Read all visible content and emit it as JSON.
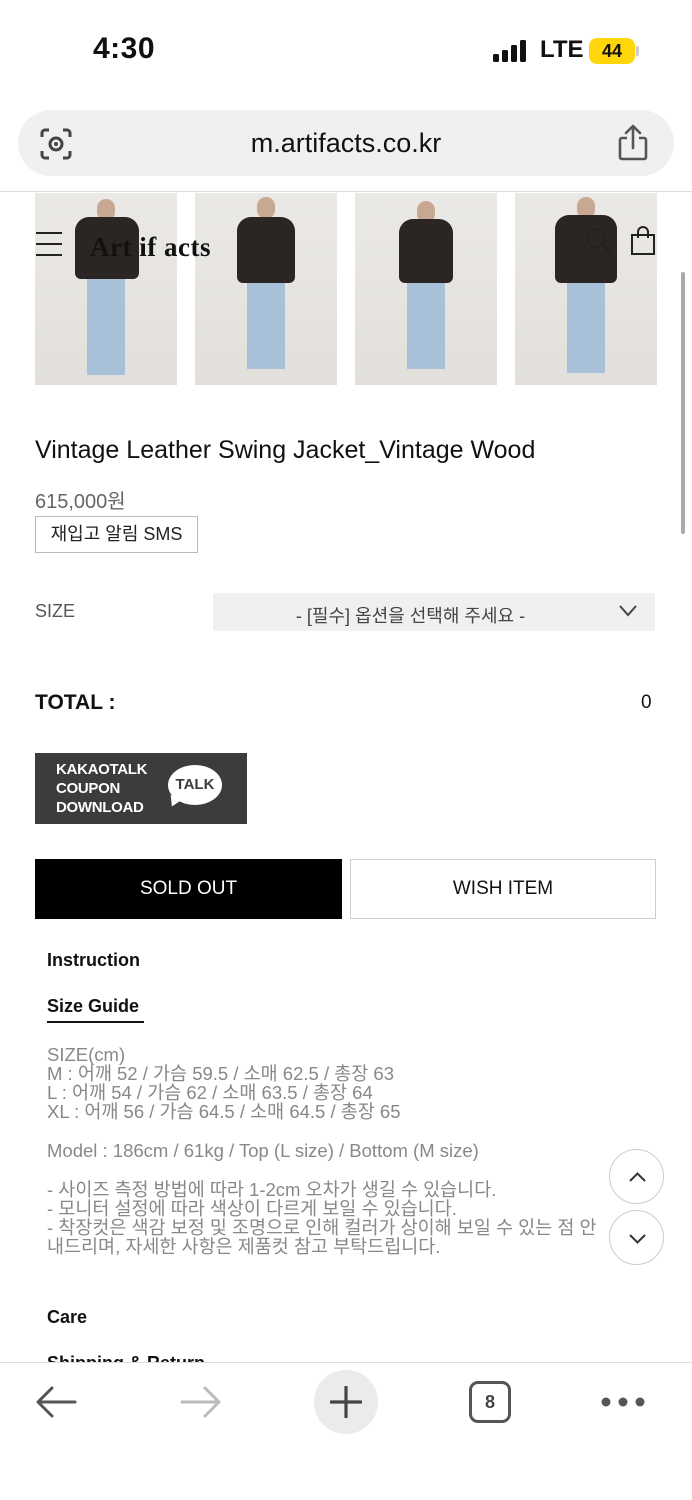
{
  "status_bar": {
    "time": "4:30",
    "network": "LTE",
    "battery": "44"
  },
  "browser": {
    "url": "m.artifacts.co.kr",
    "tab_count": "8"
  },
  "site": {
    "logo": "Art if acts"
  },
  "product": {
    "title": "Vintage Leather Swing Jacket_Vintage Wood",
    "price": "615,000원",
    "restock_button": "재입고 알림 SMS",
    "size_label": "SIZE",
    "size_placeholder": "- [필수] 옵션을 선택해 주세요 -",
    "total_label": "TOTAL :",
    "total_value": "0"
  },
  "kakao_banner": {
    "lines": [
      "KAKAOTALK",
      "COUPON",
      "DOWNLOAD"
    ],
    "badge": "TALK"
  },
  "actions": {
    "sold_out": "SOLD OUT",
    "wish": "WISH ITEM"
  },
  "tabs": {
    "instruction": "Instruction",
    "size_guide": "Size Guide",
    "care": "Care",
    "shipping": "Shipping & Return"
  },
  "size_guide": {
    "measurements": [
      "SIZE(cm)",
      "M : 어깨 52 / 가슴 59.5 / 소매 62.5 / 총장 63",
      "L : 어깨 54 / 가슴 62 / 소매 63.5 / 총장 64",
      "XL : 어깨 56 / 가슴 64.5 / 소매 64.5 / 총장 65"
    ],
    "model": "Model : 186cm / 61kg / Top (L size) / Bottom (M size)",
    "notes": [
      "- 사이즈 측정 방법에 따라 1-2cm 오차가 생길 수 있습니다.",
      "- 모니터 설정에 따라 색상이 다르게 보일 수 있습니다.",
      "- 착장컷은 색감 보정 및 조명으로 인해 컬러가 상이해 보일 수 있는 점 안",
      "내드리며, 자세한 사항은 제품컷 참고 부탁드립니다."
    ]
  },
  "colors": {
    "accent": "#000000",
    "battery": "#ffd60a",
    "kakao_bg": "#3c3c3c"
  },
  "icons": [
    "signal-icon",
    "lens-icon",
    "share-icon",
    "hamburger-menu-icon",
    "search-icon",
    "cart-icon",
    "chevron-down-icon",
    "chevron-up-icon",
    "back-icon",
    "forward-icon",
    "plus-icon",
    "more-icon"
  ]
}
